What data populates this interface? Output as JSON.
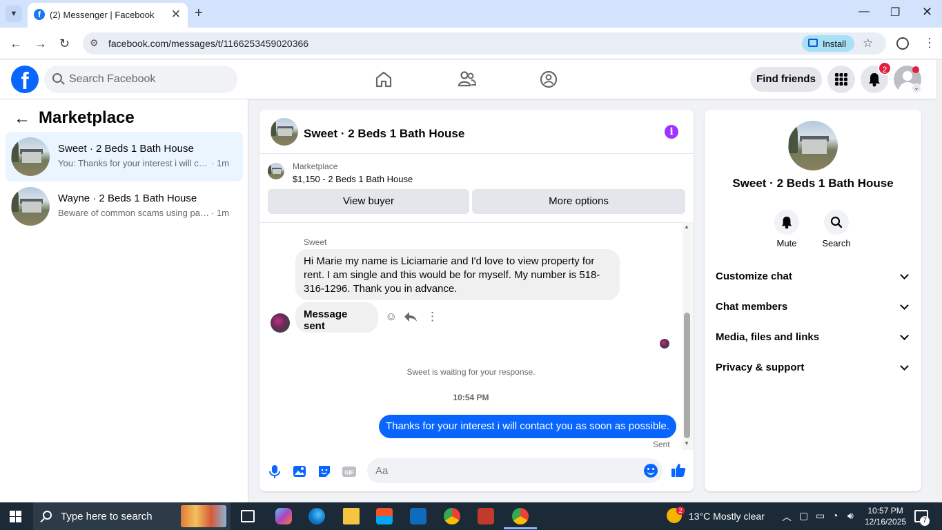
{
  "browser": {
    "tab_title": "(2) Messenger | Facebook",
    "url": "facebook.com/messages/t/1166253459020366",
    "install_label": "Install"
  },
  "header": {
    "search_placeholder": "Search Facebook",
    "find_friends": "Find friends",
    "notification_count": "2"
  },
  "sidebar": {
    "title": "Marketplace",
    "conversations": [
      {
        "name": "Sweet · 2 Beds 1 Bath House",
        "preview": "You: Thanks for your interest i will contact you as soon as possible.",
        "time": "· 1m",
        "active": true
      },
      {
        "name": "Wayne · 2 Beds 1 Bath House",
        "preview": "Beware of common scams using payment apps",
        "time": "· 1m",
        "active": false
      }
    ]
  },
  "chat": {
    "title": "Sweet · 2 Beds 1 Bath House",
    "listing_label": "Marketplace",
    "listing_price": "$1,150 - 2 Beds 1 Bath House",
    "view_buyer": "View buyer",
    "more_options": "More options",
    "sender_name": "Sweet",
    "messages": [
      {
        "text": "Hi Marie my name is Liciamarie and I'd love to view property for rent. I am single and this would be for myself. My number is 518-316-1296. Thank you in advance."
      },
      {
        "text": "Message sent"
      }
    ],
    "waiting_notice": "Sweet is waiting for your response.",
    "timestamp": "10:54 PM",
    "outgoing": "Thanks for your interest i will contact you as soon as possible.",
    "sent_status": "Sent",
    "composer_placeholder": "Aa"
  },
  "right_panel": {
    "title": "Sweet · 2 Beds 1 Bath House",
    "mute": "Mute",
    "search": "Search",
    "sections": [
      "Customize chat",
      "Chat members",
      "Media, files and links",
      "Privacy & support"
    ]
  },
  "taskbar": {
    "search_placeholder": "Type here to search",
    "weather_badge": "2",
    "weather": "13°C  Mostly clear",
    "time": "10:57 PM",
    "date": "12/16/2025",
    "notif_count": "7"
  },
  "colors": {
    "fb_blue": "#0866ff",
    "badge_red": "#e41e3f",
    "info_purple": "#a033ff"
  }
}
